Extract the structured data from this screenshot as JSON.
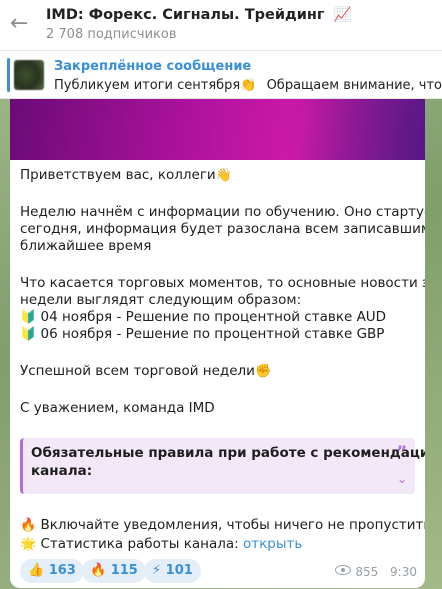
{
  "header": {
    "title": "IMD: Форекс. Сигналы. Трейдинг",
    "title_emoji": "📈",
    "subscribers": "2 708 подписчиков"
  },
  "pinned": {
    "label": "Закреплённое сообщение",
    "text": "Публикуем итоги сентября",
    "emoji": "👏",
    "text2": "Обращаем внимание, что мы н"
  },
  "message": {
    "greeting": "Приветствуем вас, коллеги",
    "greeting_emoji": "👋",
    "line1": "Неделю начнём с информации по обучению. Оно стартует",
    "line2": "сегодня, информация будет разослана всем записавшимся в",
    "line3": "ближайшее время",
    "line4": "Что касается торговых моментов, то основные новости этой",
    "line5": "недели выглядят следующим образом:",
    "news": [
      {
        "emoji": "🔰",
        "text": "04 ноября - Решение по процентной ставке AUD"
      },
      {
        "emoji": "🔰",
        "text": "06 ноября - Решение по процентной ставке GBP"
      }
    ],
    "wish": "Успешной всем торговой недели",
    "wish_emoji": "✊",
    "signature": "С уважением, команда IMD",
    "quote": {
      "line1": "Обязательные правила при работе с рекомендациями",
      "line2": "канала:"
    },
    "notify_emoji": "🔥",
    "notify": "Включайте уведомления, чтобы ничего не пропустить",
    "stats_emoji": "🌟",
    "stats_label": "Статистика работы канала:",
    "stats_link": "открыть",
    "reactions": [
      {
        "emoji": "👍",
        "count": "163"
      },
      {
        "emoji": "🔥",
        "count": "115"
      },
      {
        "emoji": "⚡",
        "count": "101"
      }
    ],
    "views": "855",
    "time": "9:30"
  },
  "colors": {
    "accent": "#3a8fd6",
    "quote_border": "#b06fd8",
    "chat_bg": "#8aa57a"
  }
}
